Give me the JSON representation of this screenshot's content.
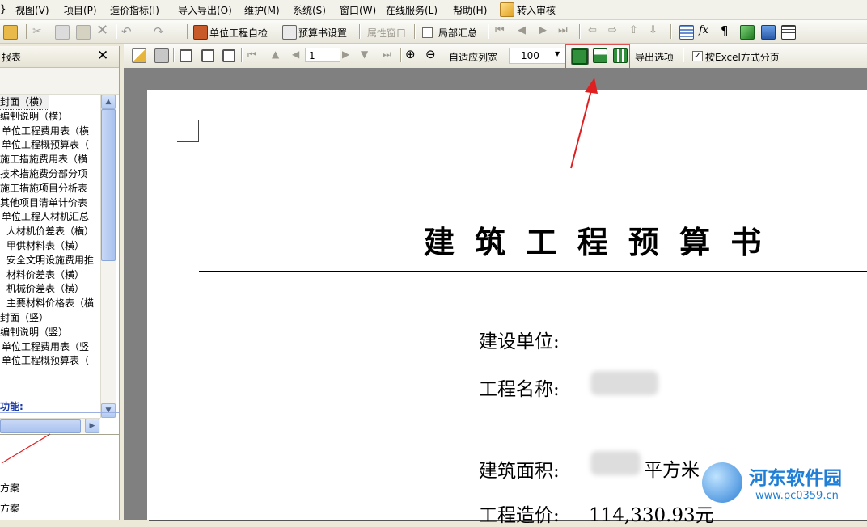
{
  "menu": {
    "items": [
      "}",
      "视图(V)",
      "项目(P)",
      "造价指标(I)",
      "导入导出(O)",
      "维护(M)",
      "系统(S)",
      "窗口(W)",
      "在线服务(L)",
      "帮助(H)",
      "转入审核"
    ]
  },
  "toolbar1": {
    "self_check": "单位工程自检",
    "budget_settings": "预算书设置",
    "property_window": "属性窗口",
    "partial_summary": "局部汇总"
  },
  "toolbar2": {
    "page_number": "1",
    "fit_width": "自适应列宽",
    "zoom": "100",
    "export_options": "导出选项",
    "excel_paging": "按Excel方式分页",
    "excel_paging_checked": true
  },
  "left_panel": {
    "title": "报表",
    "close": "✕",
    "tree": [
      "封面（横）",
      "编制说明（横）",
      "单位工程费用表（横",
      "单位工程概预算表（",
      "施工措施费用表（横",
      "技术措施费分部分项",
      "施工措施项目分析表",
      "其他项目清单计价表",
      "单位工程人材机汇总",
      "人材机价差表（横）",
      "甲供材料表（横）",
      "安全文明设施费用推",
      "材料价差表（横）",
      "机械价差表（横）",
      "主要材料价格表（横",
      "封面（竖）",
      "编制说明（竖）",
      "单位工程费用表（竖",
      "单位工程概预算表（"
    ],
    "func_label": "功能:",
    "bottom_items": [
      "方案",
      "方案"
    ]
  },
  "document": {
    "title": "建 筑 工 程 预 算 书",
    "construction_unit": "建设单位:",
    "project_name": "工程名称:",
    "building_area": "建筑面积:",
    "area_unit": "平方米",
    "project_cost": "工程造价:",
    "cost_value": "114,330.93元"
  },
  "watermark": {
    "name": "河东软件园",
    "url": "www.pc0359.cn"
  },
  "colors": {
    "highlight_box": "#e05050",
    "arrow": "#e02020",
    "watermark_blue": "#1f7fd6"
  }
}
